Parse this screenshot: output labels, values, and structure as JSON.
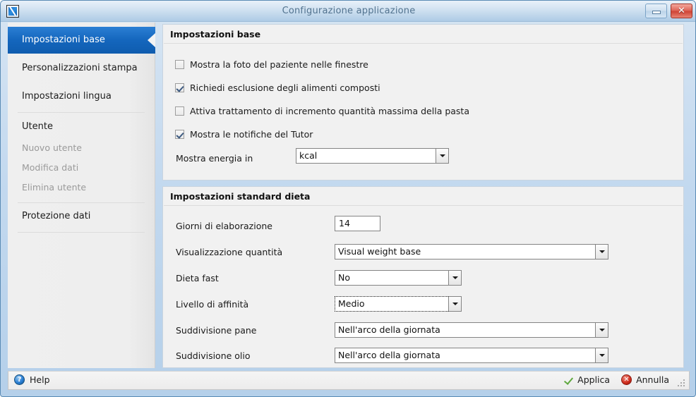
{
  "window": {
    "title": "Configurazione applicazione",
    "app_icon": "app-icon",
    "minimize_label": "",
    "close_label": "✕"
  },
  "sidebar": {
    "items": [
      {
        "label": "Impostazioni base",
        "state": "selected"
      },
      {
        "label": "Personalizzazioni stampa",
        "state": "normal"
      },
      {
        "label": "Impostazioni lingua",
        "state": "normal"
      },
      {
        "label": "Utente",
        "state": "normal"
      },
      {
        "label": "Nuovo utente",
        "state": "disabled"
      },
      {
        "label": "Modifica dati",
        "state": "disabled"
      },
      {
        "label": "Elimina utente",
        "state": "disabled"
      },
      {
        "label": "Protezione dati",
        "state": "normal"
      }
    ]
  },
  "base_settings": {
    "title": "Impostazioni base",
    "checkboxes": [
      {
        "label": "Mostra la foto del paziente nelle finestre",
        "checked": false
      },
      {
        "label": "Richiedi esclusione degli alimenti composti",
        "checked": true
      },
      {
        "label": "Attiva trattamento di incremento quantità massima della pasta",
        "checked": false
      },
      {
        "label": "Mostra le notifiche del Tutor",
        "checked": true
      }
    ],
    "energy": {
      "label": "Mostra energia in",
      "value": "kcal"
    }
  },
  "diet_settings": {
    "title": "Impostazioni standard dieta",
    "days": {
      "label": "Giorni di elaborazione",
      "value": "14"
    },
    "fields": [
      {
        "label": "Visualizzazione quantità",
        "value": "Visual weight base",
        "focused": false
      },
      {
        "label": "Dieta fast",
        "value": "No",
        "focused": false
      },
      {
        "label": "Livello di affinità",
        "value": "Medio",
        "focused": true
      },
      {
        "label": "Suddivisione pane",
        "value": "Nell'arco della giornata",
        "focused": false
      },
      {
        "label": "Suddivisione olio",
        "value": "Nell'arco della giornata",
        "focused": false
      }
    ]
  },
  "statusbar": {
    "help_label": "Help",
    "help_icon": "?",
    "apply_label": "Applica",
    "cancel_label": "Annulla",
    "cancel_icon": "✕"
  },
  "colors": {
    "accent": "#1466bd",
    "title_text": "#52738f",
    "panel_bg": "#f1f1f1",
    "ok_green": "#5fa83f",
    "cancel_red": "#cf2c1c"
  }
}
